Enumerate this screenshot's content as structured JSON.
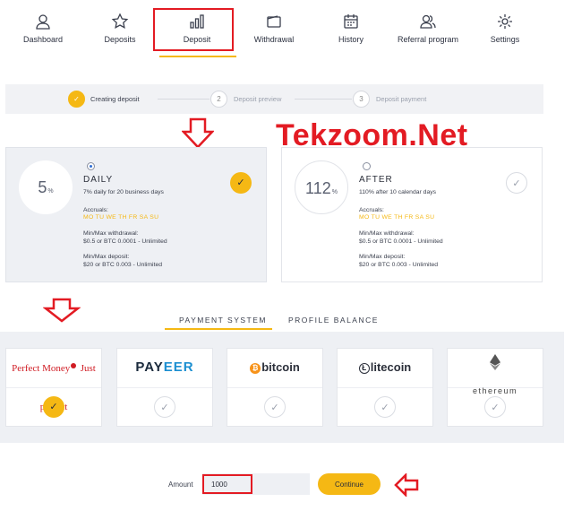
{
  "nav": {
    "items": [
      {
        "label": "Dashboard",
        "icon": "user-icon"
      },
      {
        "label": "Deposits",
        "icon": "star-icon"
      },
      {
        "label": "Deposit",
        "icon": "bar-chart-icon"
      },
      {
        "label": "Withdrawal",
        "icon": "wallet-icon"
      },
      {
        "label": "History",
        "icon": "calendar-icon"
      },
      {
        "label": "Referral program",
        "icon": "users-icon"
      },
      {
        "label": "Settings",
        "icon": "gear-icon"
      }
    ],
    "active": "Deposit"
  },
  "steps": [
    {
      "number": "1",
      "label": "Creating deposit",
      "done": true
    },
    {
      "number": "2",
      "label": "Deposit preview",
      "done": false
    },
    {
      "number": "3",
      "label": "Deposit payment",
      "done": false
    }
  ],
  "watermark": "Tekzoom.Net",
  "plans": [
    {
      "percent": "5",
      "percent_unit": "%",
      "name": "DAILY",
      "description": "7% daily for 20 business days",
      "accruals_label": "Accruals:",
      "days": "MO TU WE TH FR SA SU",
      "withdrawal_label": "Min/Max withdrawal:",
      "withdrawal_value": "$0.5 or BTC 0.0001 - Unlimited",
      "deposit_label": "Min/Max deposit:",
      "deposit_value": "$20 or BTC 0.003 - Unlimited",
      "selected": true
    },
    {
      "percent": "112",
      "percent_unit": "%",
      "name": "AFTER",
      "description": "110% after 10 calendar days",
      "accruals_label": "Accruals:",
      "days": "MO TU WE TH FR SA SU",
      "withdrawal_label": "Min/Max withdrawal:",
      "withdrawal_value": "$0.5 or BTC 0.0001 - Unlimited",
      "deposit_label": "Min/Max deposit:",
      "deposit_value": "$20 or BTC 0.003 - Unlimited",
      "selected": false
    }
  ],
  "tabs": {
    "payment_system": "PAYMENT SYSTEM",
    "profile_balance": "PROFILE BALANCE"
  },
  "payments": {
    "perfect_money": {
      "name": "Perfect Money",
      "tagline": "Just perfect",
      "selected": true
    },
    "payeer": {
      "name_left": "PAY",
      "name_right": "EER",
      "selected": false
    },
    "bitcoin": {
      "glyph": "₿",
      "name": "bitcoin",
      "selected": false
    },
    "litecoin": {
      "glyph": "Ł",
      "name": "litecoin",
      "selected": false
    },
    "ethereum": {
      "name": "ethereum",
      "selected": false
    }
  },
  "check_glyph": "✓",
  "amount": {
    "label": "Amount",
    "value": "1000"
  },
  "continue_label": "Continue",
  "colors": {
    "accent": "#f5b814",
    "highlight": "#e31b23"
  }
}
